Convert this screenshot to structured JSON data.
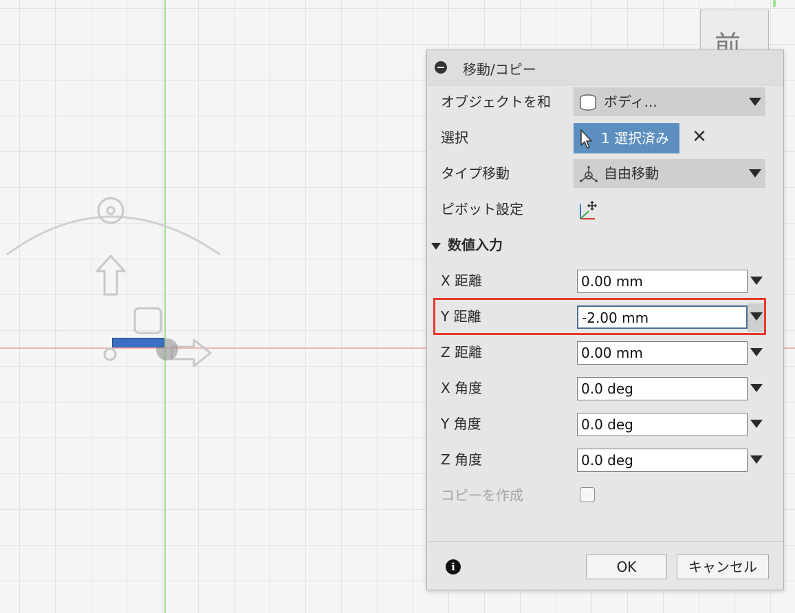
{
  "viewcube": {
    "face_label": "前"
  },
  "dialog": {
    "title": "移動/コピー",
    "object_row": {
      "label": "オブジェクトを和",
      "value": "ボディ..."
    },
    "selection_row": {
      "label": "選択",
      "value": "1 選択済み",
      "clear_symbol": "✕"
    },
    "move_type_row": {
      "label": "タイプ移動",
      "value": "自由移動"
    },
    "pivot_row": {
      "label": "ピボット設定"
    },
    "numeric_section": {
      "label": "数値入力"
    },
    "fields": [
      {
        "label": "X 距離",
        "value": "0.00 mm"
      },
      {
        "label": "Y 距離",
        "value": "-2.00 mm"
      },
      {
        "label": "Z 距離",
        "value": "0.00 mm"
      },
      {
        "label": "X 角度",
        "value": "0.0 deg"
      },
      {
        "label": "Y 角度",
        "value": "0.0 deg"
      },
      {
        "label": "Z 角度",
        "value": "0.0 deg"
      }
    ],
    "create_copy": {
      "label": "コピーを作成",
      "checked": false
    },
    "info_symbol": "i",
    "ok_label": "OK",
    "cancel_label": "キャンセル"
  },
  "colors": {
    "selection_accent": "#5c8fc0",
    "highlight_border": "#e8382c",
    "body_fill": "#3b6fc2"
  }
}
